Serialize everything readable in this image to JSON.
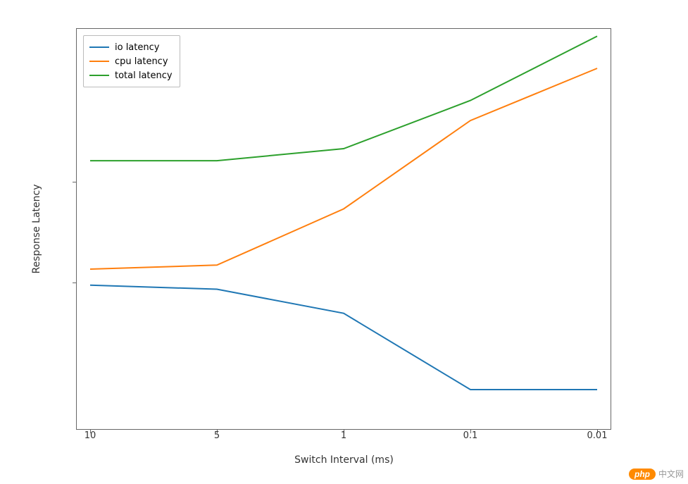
{
  "chart_data": {
    "type": "line",
    "xlabel": "Switch Interval (ms)",
    "ylabel": "Response Latency",
    "categories": [
      "10",
      "5",
      "1",
      "0.1",
      "0.01"
    ],
    "ylim": [
      0,
      100
    ],
    "series": [
      {
        "name": "io latency",
        "color": "#1f77b4",
        "values": [
          36,
          35,
          29,
          10,
          10
        ]
      },
      {
        "name": "cpu latency",
        "color": "#ff7f0e",
        "values": [
          40,
          41,
          55,
          77,
          90
        ]
      },
      {
        "name": "total latency",
        "color": "#2ca02c",
        "values": [
          67,
          67,
          70,
          82,
          98
        ]
      }
    ],
    "legend_position": "upper left",
    "grid": false,
    "y_ticks_visible": [
      40,
      65
    ]
  },
  "x_ticks": {
    "t0": "10",
    "t1": "5",
    "t2": "1",
    "t3": "0.1",
    "t4": "0.01"
  },
  "legend": {
    "l0": "io latency",
    "l1": "cpu latency",
    "l2": "total latency"
  },
  "axis": {
    "x": "Switch Interval (ms)",
    "y": "Response Latency"
  },
  "watermark": {
    "badge": "php",
    "text": "中文网"
  }
}
